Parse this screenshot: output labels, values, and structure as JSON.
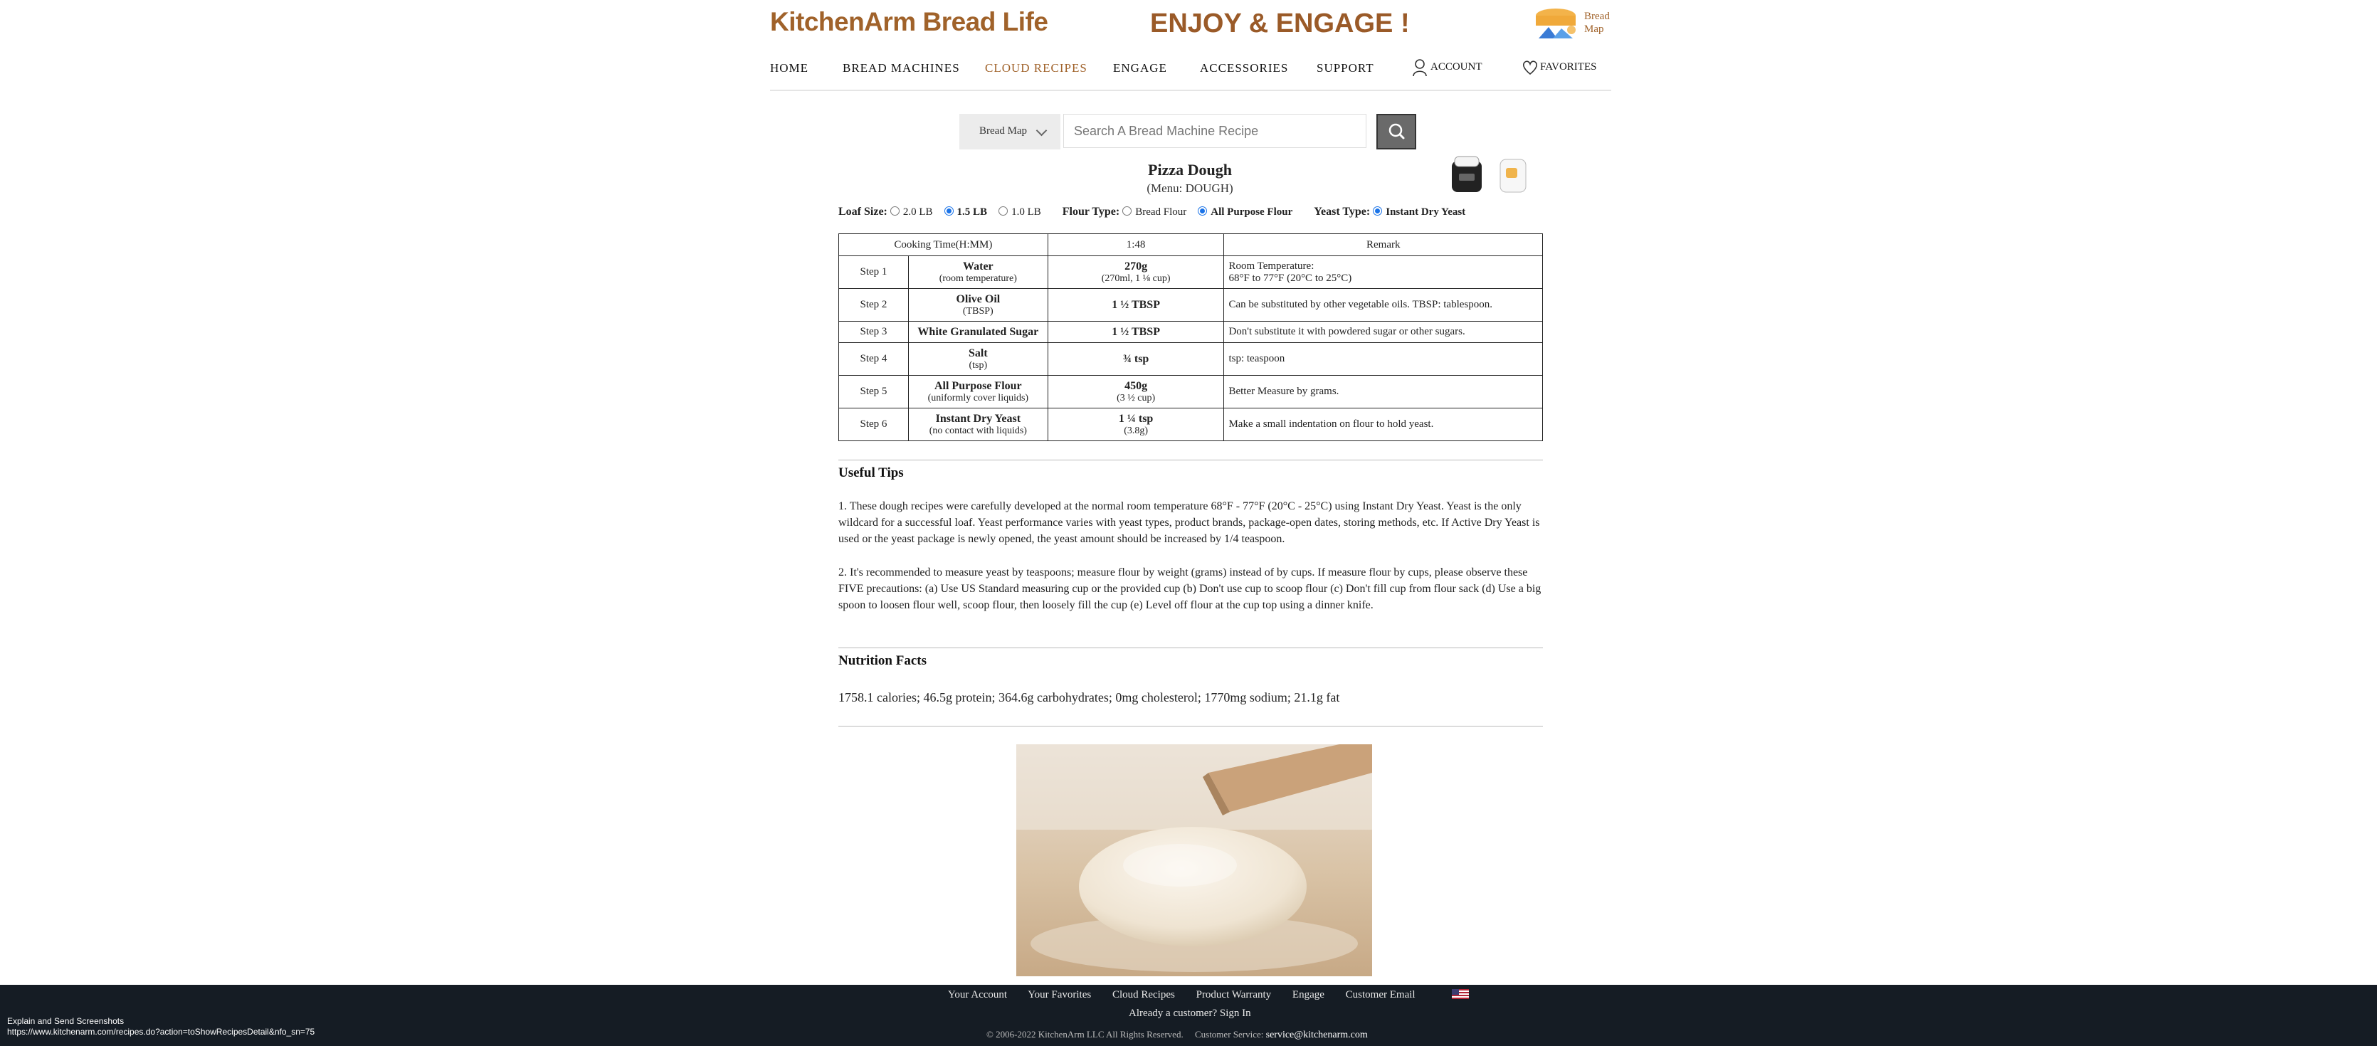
{
  "header": {
    "logo": "KitchenArm Bread Life",
    "tagline": "ENJOY & ENGAGE !",
    "bread_map": "Bread Map"
  },
  "nav": {
    "home": "HOME",
    "bread_machines": "BREAD MACHINES",
    "cloud_recipes": "CLOUD RECIPES",
    "engage": "ENGAGE",
    "accessories": "ACCESSORIES",
    "support": "SUPPORT",
    "account": "ACCOUNT",
    "favorites": "FAVORITES"
  },
  "search": {
    "selector": "Bread Map",
    "placeholder": "Search A Bread Machine Recipe"
  },
  "recipe": {
    "title": "Pizza Dough",
    "menu": "(Menu: DOUGH)"
  },
  "options": {
    "loaf_label": "Loaf Size:",
    "loaf": [
      "2.0 LB",
      "1.5 LB",
      "1.0 LB"
    ],
    "flour_label": "Flour Type:",
    "flour": [
      "Bread Flour",
      "All Purpose Flour"
    ],
    "yeast_label": "Yeast Type:",
    "yeast": [
      "Instant Dry Yeast"
    ]
  },
  "table": {
    "head": [
      "Cooking Time(H:MM)",
      "1:48",
      "Remark"
    ],
    "rows": [
      {
        "step": "Step 1",
        "ing": "Water",
        "sub": "(room temperature)",
        "amt": "270g",
        "amt_sub": "(270ml, 1 ⅛ cup)",
        "remark": "Room Temperature:",
        "remark2": "68°F to 77°F (20°C to 25°C)"
      },
      {
        "step": "Step 2",
        "ing": "Olive Oil",
        "sub": "(TBSP)",
        "amt": "1 ½ TBSP",
        "amt_sub": "",
        "remark": "Can be substituted by other vegetable oils. TBSP: tablespoon.",
        "remark2": ""
      },
      {
        "step": "Step 3",
        "ing": "White Granulated Sugar",
        "sub": "",
        "amt": "1 ½ TBSP",
        "amt_sub": "",
        "remark": "Don't substitute it with powdered sugar or other sugars.",
        "remark2": ""
      },
      {
        "step": "Step 4",
        "ing": "Salt",
        "sub": "(tsp)",
        "amt": "¾ tsp",
        "amt_sub": "",
        "remark": "tsp: teaspoon",
        "remark2": ""
      },
      {
        "step": "Step 5",
        "ing": "All Purpose Flour",
        "sub": "(uniformly cover liquids)",
        "amt": "450g",
        "amt_sub": "(3 ½ cup)",
        "remark": "Better Measure by grams.",
        "remark2": ""
      },
      {
        "step": "Step 6",
        "ing": "Instant Dry Yeast",
        "sub": "(no contact with liquids)",
        "amt": "1 ¼ tsp",
        "amt_sub": "(3.8g)",
        "remark": "Make a small indentation on flour to hold yeast.",
        "remark2": ""
      }
    ]
  },
  "tips": {
    "heading": "Useful Tips",
    "tip1": "1. These dough recipes were carefully developed at the normal room temperature 68°F - 77°F (20°C - 25°C) using Instant Dry Yeast. Yeast is the only wildcard for a successful loaf. Yeast performance varies with yeast types, product brands, package-open dates, storing methods, etc. If Active Dry Yeast is used or the yeast package is newly opened, the yeast amount should be increased by 1/4 teaspoon.",
    "tip2": "2. It's recommended to measure yeast by teaspoons; measure flour by weight (grams) instead of by cups. If measure flour by cups, please observe these FIVE precautions: (a) Use US Standard measuring cup or the provided cup (b) Don't use cup to scoop flour (c) Don't fill cup from flour sack (d) Use a big spoon to loosen flour well, scoop flour, then loosely fill the cup (e) Level off flour at the cup top using a dinner knife."
  },
  "nutrition": {
    "heading": "Nutrition Facts",
    "text": "1758.1 calories; 46.5g protein; 364.6g carbohydrates; 0mg cholesterol; 1770mg sodium; 21.1g fat"
  },
  "footer": {
    "links": [
      "Your Account",
      "Your Favorites",
      "Cloud Recipes",
      "Product Warranty",
      "Engage",
      "Customer Email"
    ],
    "sign": "Already a customer? Sign In",
    "copyright": "© 2006-2022 KitchenArm LLC All Rights Reserved.",
    "service_label": "Customer Service:",
    "service_email": "service@kitchenarm.com"
  },
  "status": {
    "line1": "Explain and Send Screenshots",
    "line2": "https://www.kitchenarm.com/recipes.do?action=toShowRecipesDetail&nfo_sn=75"
  },
  "colors": {
    "brand": "#a0622a",
    "footer_bg": "#151c24",
    "radio_on": "#1a73e8"
  }
}
